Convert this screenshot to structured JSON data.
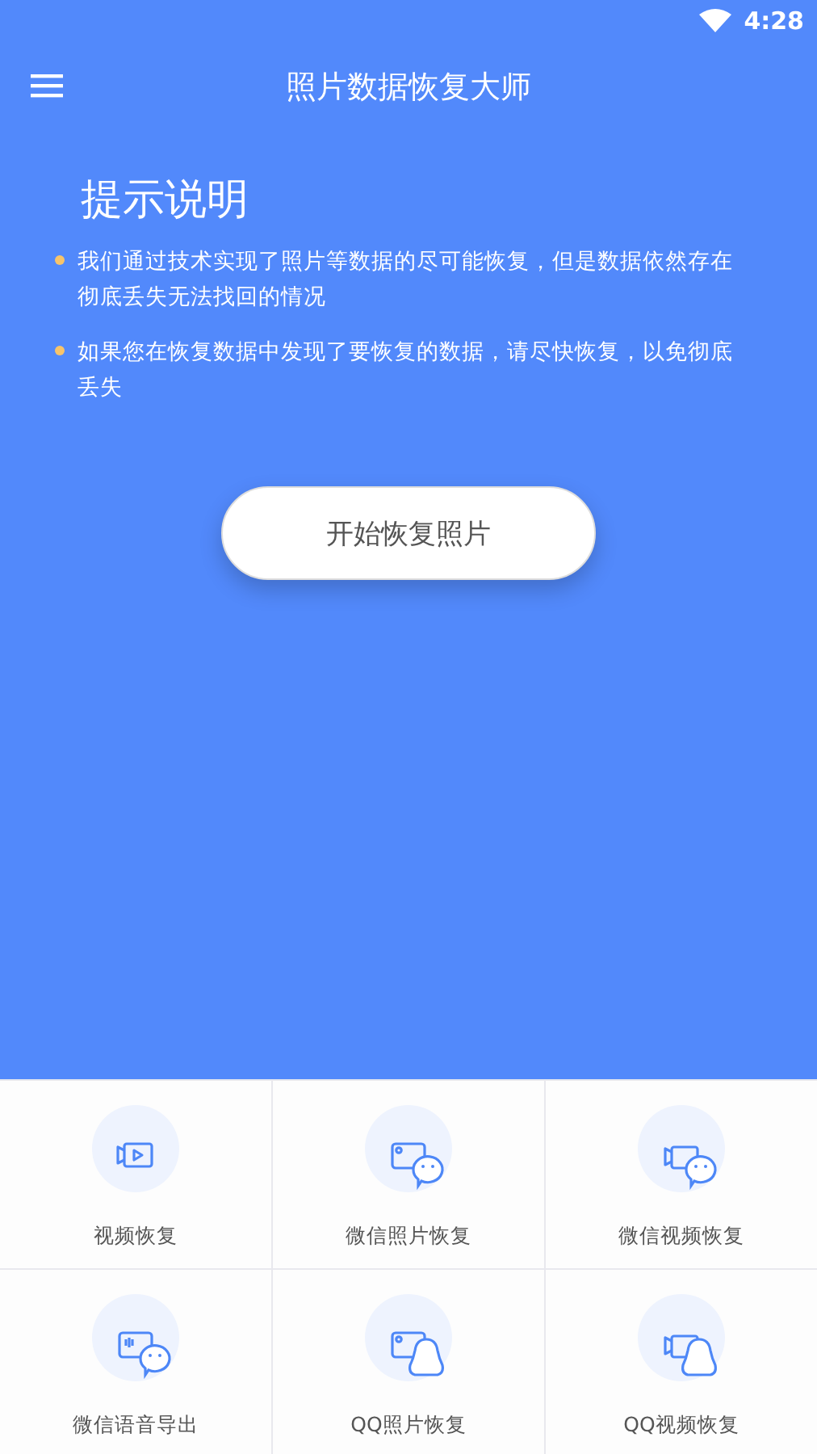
{
  "status_bar": {
    "time": "4:28"
  },
  "toolbar": {
    "title": "照片数据恢复大师"
  },
  "notice": {
    "heading": "提示说明",
    "points": [
      "我们通过技术实现了照片等数据的尽可能恢复，但是数据依然存在彻底丢失无法找回的情况",
      "如果您在恢复数据中发现了要恢复的数据，请尽快恢复，以免彻底丢失"
    ]
  },
  "start_button": {
    "label": "开始恢复照片"
  },
  "features": [
    {
      "kind": "video",
      "label": "视频恢复"
    },
    {
      "kind": "wechat-photo",
      "label": "微信照片恢复"
    },
    {
      "kind": "wechat-video",
      "label": "微信视频恢复"
    },
    {
      "kind": "wechat-voice",
      "label": "微信语音导出"
    },
    {
      "kind": "qq-photo",
      "label": "QQ照片恢复"
    },
    {
      "kind": "qq-video",
      "label": "QQ视频恢复"
    }
  ]
}
